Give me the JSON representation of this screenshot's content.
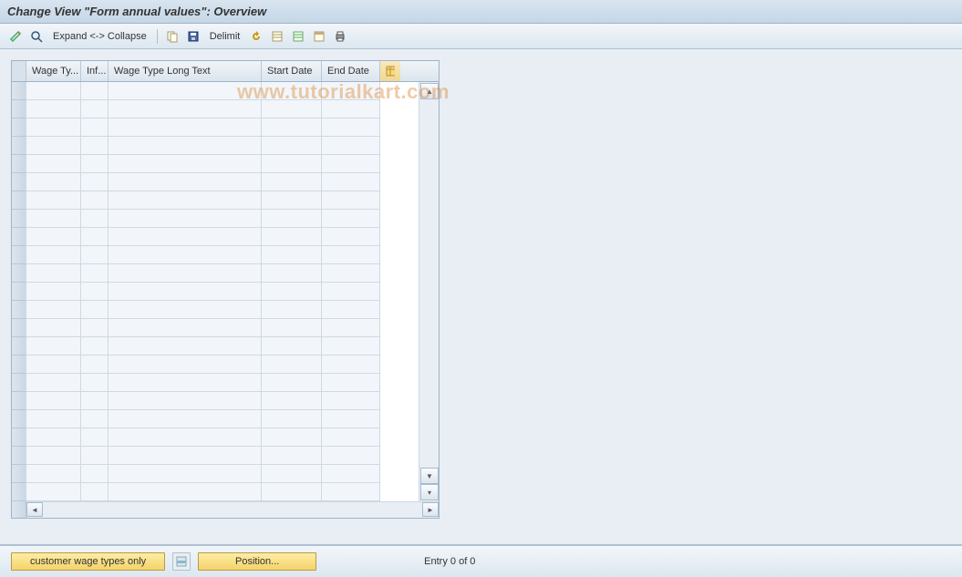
{
  "title": "Change View \"Form annual values\": Overview",
  "toolbar": {
    "expand_collapse": "Expand <-> Collapse",
    "delimit": "Delimit"
  },
  "table": {
    "columns": {
      "wage_type": "Wage Ty...",
      "info": "Inf...",
      "long_text": "Wage Type Long Text",
      "start_date": "Start Date",
      "end_date": "End Date"
    },
    "rows": []
  },
  "footer": {
    "customer_btn": "customer wage types only",
    "position_btn": "Position...",
    "entry_text": "Entry 0 of 0"
  },
  "watermark": "www.tutorialkart.com"
}
